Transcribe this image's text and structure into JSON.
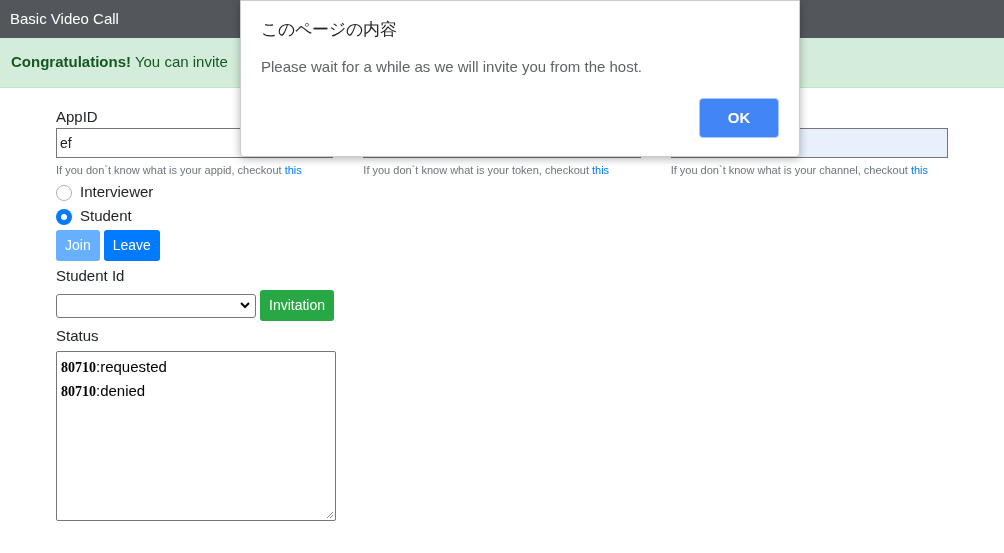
{
  "navbar": {
    "title": "Basic Video Call"
  },
  "alert": {
    "text": "**Congratulations!** You can invite"
  },
  "fields": [
    {
      "label": "AppID",
      "value": "ef",
      "hint": "If you don`t know what is your appid, checkout",
      "link": "this"
    },
    {
      "hint": "If you don`t know what is your token, checkout",
      "link": "this"
    },
    {
      "hint": "If you don`t know what is your channel, checkout",
      "link": "this",
      "autofilled": true
    }
  ],
  "roles": [
    {
      "label": "Interviewer",
      "selected": false
    },
    {
      "label": "Student",
      "selected": true
    }
  ],
  "buttons": [
    {
      "label": "Join",
      "disabled": true
    },
    {
      "label": "Leave",
      "disabled": false
    }
  ],
  "student_id": {
    "label": "Student Id",
    "button": "Invitation"
  },
  "status": {
    "label": "Status",
    "lines": [
      "**80710**:requested",
      "**80710**:denied"
    ]
  },
  "dialog": {
    "title": "このページの内容",
    "message": "Please wait for a while as we will invite you from the host.",
    "button": "OK"
  }
}
